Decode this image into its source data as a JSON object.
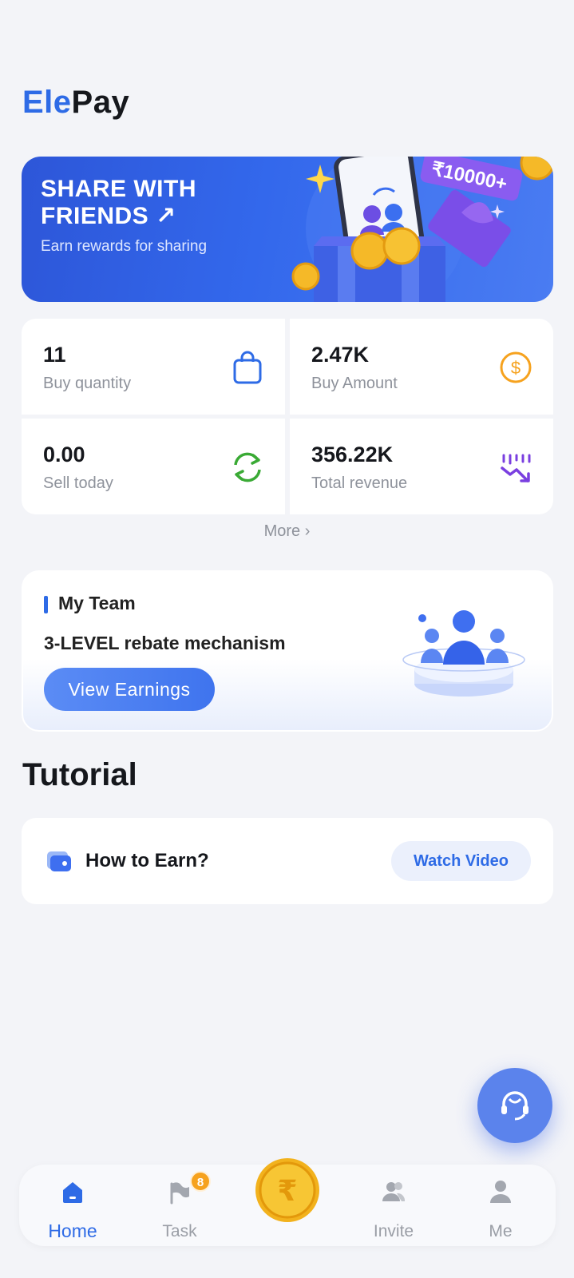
{
  "app": {
    "logo_part1": "Ele",
    "logo_part2": "Pay"
  },
  "banner": {
    "title_line1": "SHARE WITH",
    "title_line2": "FRIENDS ↗",
    "subtitle": "Earn rewards for sharing",
    "reward_tag": "₹10000+"
  },
  "stats": [
    {
      "value": "11",
      "label": "Buy quantity",
      "icon": "shopping-bag-icon"
    },
    {
      "value": "2.47K",
      "label": "Buy Amount",
      "icon": "dollar-coin-icon"
    },
    {
      "value": "0.00",
      "label": "Sell today",
      "icon": "refresh-icon"
    },
    {
      "value": "356.22K",
      "label": "Total revenue",
      "icon": "trending-down-icon"
    }
  ],
  "more_label": "More",
  "team": {
    "heading": "My Team",
    "description": "3-LEVEL rebate mechanism",
    "button": "View Earnings"
  },
  "tutorial": {
    "title": "Tutorial",
    "item_label": "How to Earn?",
    "watch_button": "Watch Video"
  },
  "nav": {
    "items": [
      {
        "label": "Home",
        "icon": "home-icon",
        "active": true
      },
      {
        "label": "Task",
        "icon": "flag-icon",
        "badge": "8"
      },
      {
        "label": "",
        "icon": "rupee-coin-icon"
      },
      {
        "label": "Invite",
        "icon": "users-icon"
      },
      {
        "label": "Me",
        "icon": "user-icon"
      }
    ]
  },
  "colors": {
    "accent": "#2e6be6",
    "background": "#f3f4f8",
    "badge": "#f6a21e"
  }
}
